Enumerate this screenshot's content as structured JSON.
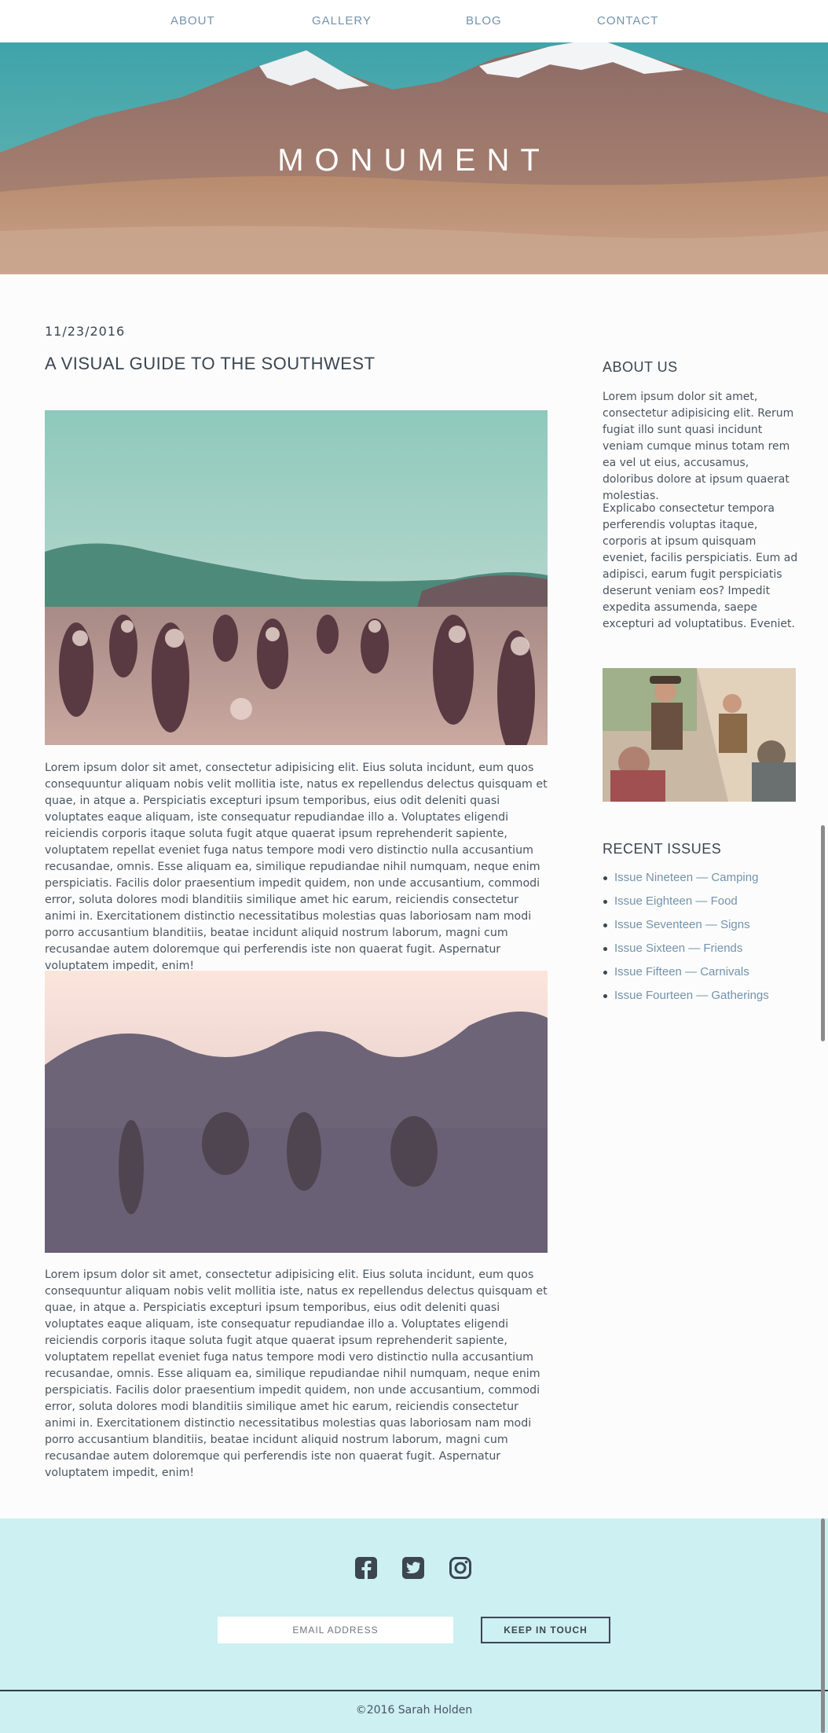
{
  "nav": {
    "items": [
      "ABOUT",
      "GALLERY",
      "BLOG",
      "CONTACT"
    ]
  },
  "hero": {
    "title": "MONUMENT"
  },
  "article": {
    "date": "11/23/2016",
    "title": "A VISUAL GUIDE TO THE SOUTHWEST",
    "paragraph1": "Lorem ipsum dolor sit amet, consectetur adipisicing elit. Eius soluta incidunt, eum quos consequuntur aliquam nobis velit mollitia iste, natus ex repellendus delectus quisquam et quae, in atque a. Perspiciatis excepturi ipsum temporibus, eius odit deleniti quasi voluptates eaque aliquam, iste consequatur repudiandae illo a. Voluptates eligendi reiciendis corporis itaque soluta fugit atque quaerat ipsum reprehenderit sapiente, voluptatem repellat eveniet fuga natus tempore modi vero distinctio nulla accusantium recusandae, omnis. Esse aliquam ea, similique repudiandae nihil numquam, neque enim perspiciatis. Facilis dolor praesentium impedit quidem, non unde accusantium, commodi error, soluta dolores modi blanditiis similique amet hic earum, reiciendis consectetur animi in. Exercitationem distinctio necessitatibus molestias quas laboriosam nam modi porro accusantium blanditiis, beatae incidunt aliquid nostrum laborum, magni cum recusandae autem doloremque qui perferendis iste non quaerat fugit. Aspernatur voluptatem impedit, enim!",
    "paragraph2": "Lorem ipsum dolor sit amet, consectetur adipisicing elit. Eius soluta incidunt, eum quos consequuntur aliquam nobis velit mollitia iste, natus ex repellendus delectus quisquam et quae, in atque a. Perspiciatis excepturi ipsum temporibus, eius odit deleniti quasi voluptates eaque aliquam, iste consequatur repudiandae illo a. Voluptates eligendi reiciendis corporis itaque soluta fugit atque quaerat ipsum reprehenderit sapiente, voluptatem repellat eveniet fuga natus tempore modi vero distinctio nulla accusantium recusandae, omnis. Esse aliquam ea, similique repudiandae nihil numquam, neque enim perspiciatis. Facilis dolor praesentium impedit quidem, non unde accusantium, commodi error, soluta dolores modi blanditiis similique amet hic earum, reiciendis consectetur animi in. Exercitationem distinctio necessitatibus molestias quas laboriosam nam modi porro accusantium blanditiis, beatae incidunt aliquid nostrum laborum, magni cum recusandae autem doloremque qui perferendis iste non quaerat fugit. Aspernatur voluptatem impedit, enim!"
  },
  "sidebar": {
    "about_heading": "ABOUT US",
    "about_p1": "Lorem ipsum dolor sit amet, consectetur adipisicing elit. Rerum fugiat illo sunt quasi incidunt veniam cumque minus totam rem ea vel ut eius, accusamus, doloribus dolore at ipsum quaerat molestias.",
    "about_p2": "Explicabo consectetur tempora perferendis voluptas itaque, corporis at ipsum quisquam eveniet, facilis perspiciatis. Eum ad adipisci, earum fugit perspiciatis deserunt veniam eos? Impedit expedita assumenda, saepe excepturi ad voluptatibus. Eveniet.",
    "recent_heading": "RECENT ISSUES",
    "issues": [
      "Issue Nineteen — Camping",
      "Issue Eighteen — Food",
      "Issue Seventeen — Signs",
      "Issue Sixteen — Friends",
      "Issue Fifteen — Carnivals",
      "Issue Fourteen — Gatherings"
    ]
  },
  "footer": {
    "social": [
      "facebook-icon",
      "twitter-icon",
      "instagram-icon"
    ],
    "email_placeholder": "EMAIL ADDRESS",
    "button_label": "KEEP IN TOUCH",
    "copyright": "©2016 Sarah Holden"
  },
  "colors": {
    "accent": "#7393ad",
    "text": "#4a5561",
    "footer_bg": "#cdf0f2"
  }
}
